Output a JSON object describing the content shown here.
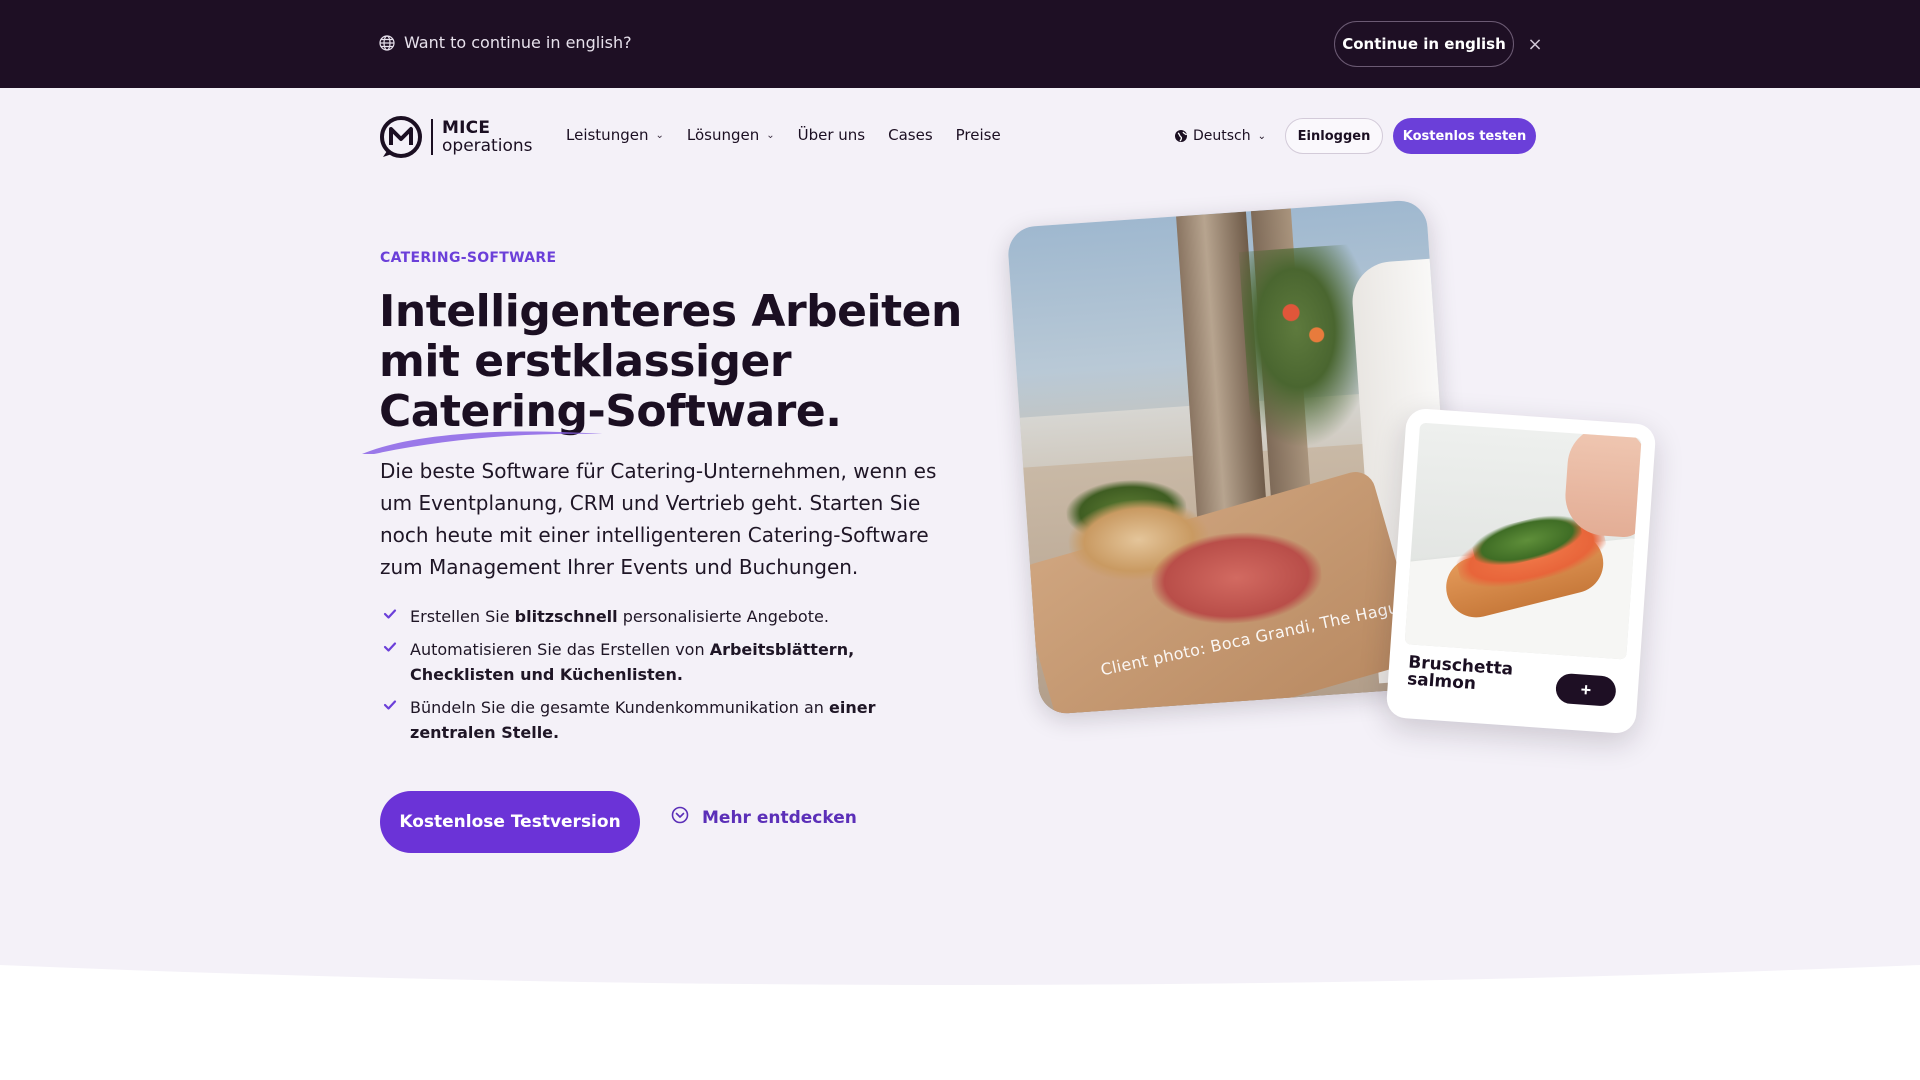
{
  "banner": {
    "question": "Want to continue in english?",
    "continue_label": "Continue in english",
    "close_label": "×"
  },
  "nav": {
    "logo_line1": "MICE",
    "logo_line2": "operations",
    "menu": [
      {
        "label": "Leistungen",
        "has_dropdown": true
      },
      {
        "label": "Lösungen",
        "has_dropdown": true
      },
      {
        "label": "Über uns",
        "has_dropdown": false
      },
      {
        "label": "Cases",
        "has_dropdown": false
      },
      {
        "label": "Preise",
        "has_dropdown": false
      }
    ],
    "language": "Deutsch",
    "login_label": "Einloggen",
    "trial_label": "Kostenlos testen"
  },
  "hero": {
    "eyebrow": "CATERING-SOFTWARE",
    "headline_line1": "Intelligenteres Arbeiten",
    "headline_line2": "mit erstklassiger",
    "headline_line3": "Catering-Software.",
    "lead": "Die beste Software für Catering-Unternehmen, wenn es um Eventplanung, CRM und Vertrieb geht. Starten Sie noch heute mit einer intelligenteren Catering-Software zum Management Ihrer Events und Buchungen.",
    "bullets": [
      {
        "pre": "Erstellen Sie ",
        "bold": "blitzschnell",
        "post": " personalisierte Angebote."
      },
      {
        "pre": "Automatisieren Sie das Erstellen von ",
        "bold": "Arbeitsblättern, Checklisten und Küchenlisten.",
        "post": ""
      },
      {
        "pre": "Bündeln Sie die gesamte Kundenkommunikation an ",
        "bold": "einer zentralen Stelle.",
        "post": ""
      }
    ],
    "cta_label": "Kostenlose Testversion",
    "more_label": "Mehr entdecken"
  },
  "media": {
    "photo_credit": "Client photo: Boca Grandi, The Hague",
    "card_title": "Bruschetta salmon",
    "card_add_label": "+"
  },
  "colors": {
    "accent": "#6b3fd9",
    "banner_bg": "#1e0f24",
    "page_bg": "#f4f1f8",
    "text": "#1b0f22"
  }
}
